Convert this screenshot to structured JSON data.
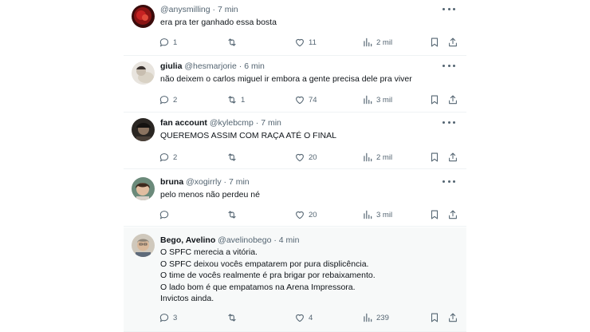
{
  "tweets": [
    {
      "display_name": "",
      "handle": "@anysmilling",
      "time": "7 min",
      "lines": [
        "era pra ter ganhado essa bosta"
      ],
      "replies": "1",
      "retweets": "",
      "likes": "11",
      "views": "2 mil",
      "avatar": "avatar-red"
    },
    {
      "display_name": "giulia",
      "handle": "@hesmarjorie",
      "time": "6 min",
      "lines": [
        "não deixem o carlos miguel ir embora a gente precisa dele pra viver"
      ],
      "replies": "2",
      "retweets": "1",
      "likes": "74",
      "views": "3 mil",
      "avatar": "avatar-photo-light"
    },
    {
      "display_name": "fan account",
      "handle": "@kylebcmp",
      "time": "7 min",
      "lines": [
        "QUEREMOS ASSIM COM RAÇA ATÉ O FINAL"
      ],
      "replies": "2",
      "retweets": "",
      "likes": "20",
      "views": "2 mil",
      "avatar": "avatar-photo-dark"
    },
    {
      "display_name": "bruna",
      "handle": "@xogirrly",
      "time": "7 min",
      "lines": [
        "pelo menos não perdeu né"
      ],
      "replies": "",
      "retweets": "",
      "likes": "20",
      "views": "3 mil",
      "avatar": "avatar-photo-face"
    },
    {
      "display_name": "Bego, Avelino",
      "handle": "@avelinobego",
      "time": "4 min",
      "lines": [
        "O SPFC merecia a vitória.",
        "O SPFC deixou vocês empatarem por pura displicência.",
        "O time de vocês realmente é pra brigar por rebaixamento.",
        "O lado bom é que empatamos na Arena Impressora.",
        "Invictos ainda."
      ],
      "replies": "3",
      "retweets": "",
      "likes": "4",
      "views": "239",
      "avatar": "avatar-photo-man"
    }
  ],
  "separator": "·",
  "icons": {
    "reply": "reply-icon",
    "retweet": "retweet-icon",
    "like": "heart-icon",
    "views": "views-icon",
    "bookmark": "bookmark-icon",
    "share": "share-icon",
    "more": "more-icon"
  },
  "colors": {
    "text": "#0f1419",
    "muted": "#536471",
    "border": "#eff3f4",
    "highlight": "#f7f9f9"
  }
}
